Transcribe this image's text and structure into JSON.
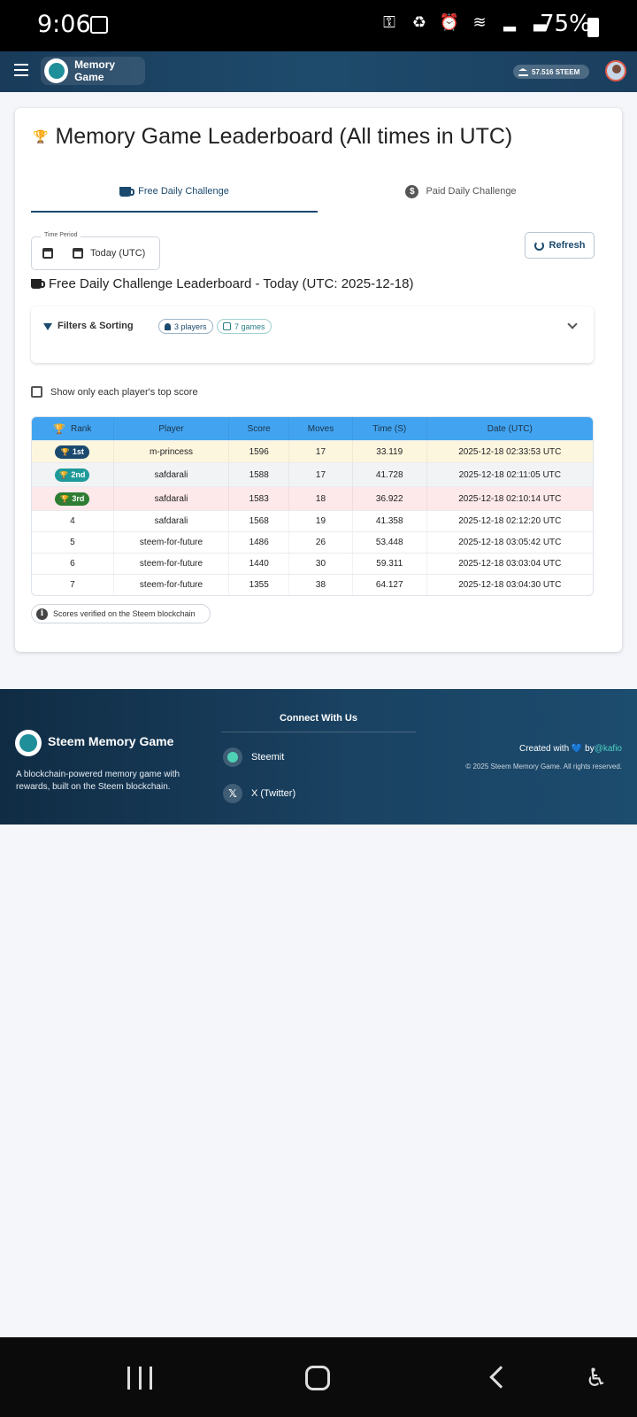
{
  "status_bar": {
    "time": "9:06",
    "battery": "75%",
    "icons": [
      "gallery-icon",
      "key-icon",
      "battery-saver-icon",
      "alarm-icon",
      "wifi-icon",
      "signal-icon",
      "signal-icon-2"
    ]
  },
  "header": {
    "brand": "Memory Game",
    "wallet": "57.516 STEEM"
  },
  "card": {
    "title": "Memory Game Leaderboard (All times in UTC)",
    "tabs": [
      {
        "label": "Free Daily Challenge",
        "active": true
      },
      {
        "label": "Paid Daily Challenge",
        "active": false
      }
    ],
    "time_period": {
      "label": "Time Period",
      "value": "Today (UTC)"
    },
    "refresh_label": "Refresh",
    "section_title": "Free Daily Challenge Leaderboard - Today (UTC: 2025-12-18)",
    "filters": {
      "label": "Filters & Sorting",
      "players_chip": "3 players",
      "games_chip": "7 games"
    },
    "checkbox_label": "Show only each player's top score",
    "table": {
      "headers": [
        "Rank",
        "Player",
        "Score",
        "Moves",
        "Time (S)",
        "Date (UTC)"
      ],
      "rows": [
        {
          "rank": "1st",
          "player": "m-princess",
          "score": "1596",
          "moves": "17",
          "time": "33.119",
          "date": "2025-12-18 02:33:53 UTC"
        },
        {
          "rank": "2nd",
          "player": "safdarali",
          "score": "1588",
          "moves": "17",
          "time": "41.728",
          "date": "2025-12-18 02:11:05 UTC"
        },
        {
          "rank": "3rd",
          "player": "safdarali",
          "score": "1583",
          "moves": "18",
          "time": "36.922",
          "date": "2025-12-18 02:10:14 UTC"
        },
        {
          "rank": "4",
          "player": "safdarali",
          "score": "1568",
          "moves": "19",
          "time": "41.358",
          "date": "2025-12-18 02:12:20 UTC"
        },
        {
          "rank": "5",
          "player": "steem-for-future",
          "score": "1486",
          "moves": "26",
          "time": "53.448",
          "date": "2025-12-18 03:05:42 UTC"
        },
        {
          "rank": "6",
          "player": "steem-for-future",
          "score": "1440",
          "moves": "30",
          "time": "59.311",
          "date": "2025-12-18 03:03:04 UTC"
        },
        {
          "rank": "7",
          "player": "steem-for-future",
          "score": "1355",
          "moves": "38",
          "time": "64.127",
          "date": "2025-12-18 03:04:30 UTC"
        }
      ]
    },
    "verified_note": "Scores verified on the Steem blockchain"
  },
  "footer": {
    "name": "Steem Memory Game",
    "description": "A blockchain-powered memory game with rewards, built on the Steem blockchain.",
    "connect_title": "Connect With Us",
    "links": [
      "Steemit",
      "X (Twitter)"
    ],
    "created_prefix": "Created with",
    "created_by": "by",
    "author": "@kafio",
    "copyright": "© 2025 Steem Memory Game. All rights reserved."
  },
  "colors": {
    "primary": "#1b4a6e",
    "table_header": "#42a4f0",
    "accent_teal": "#1f9a9a",
    "rank3_green": "#2e7d32"
  }
}
